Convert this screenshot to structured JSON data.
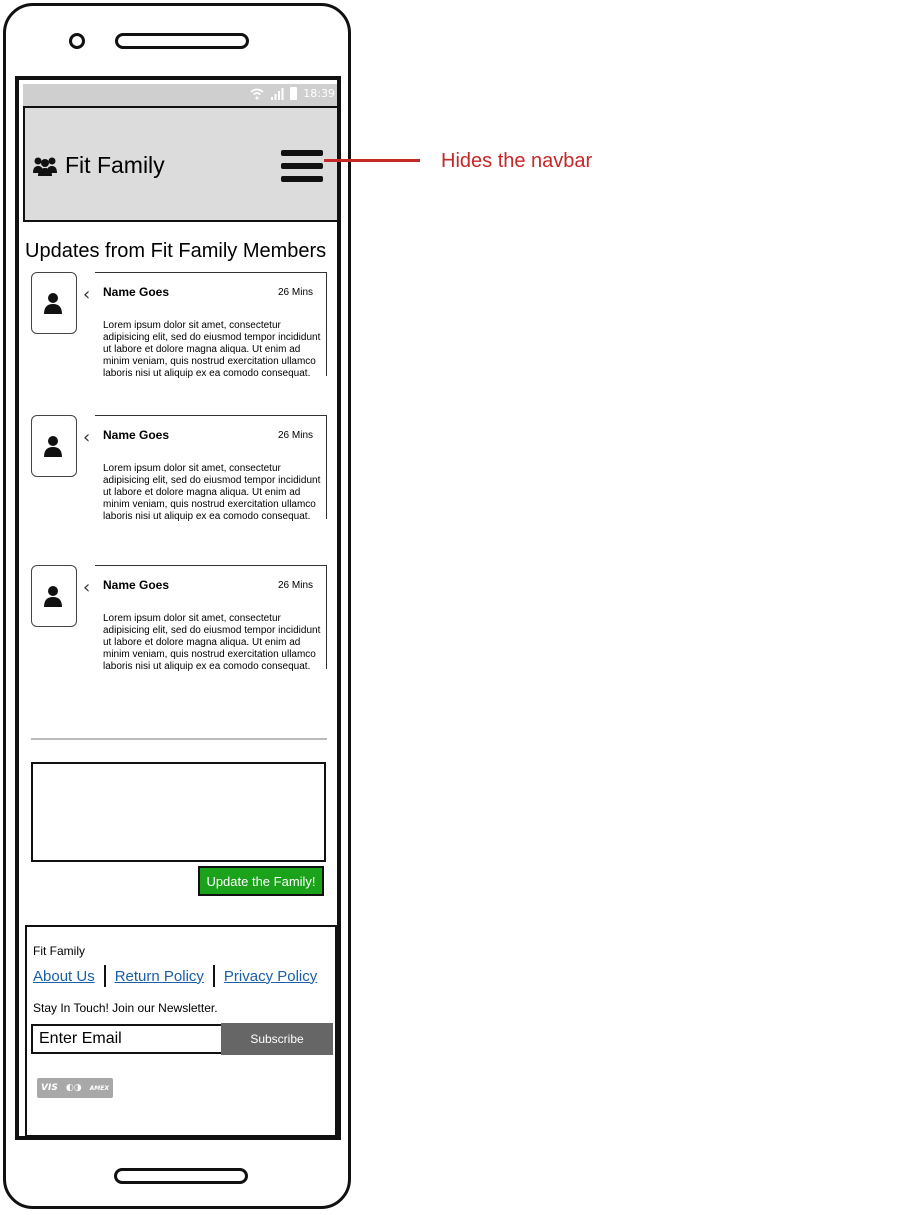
{
  "status_bar": {
    "time": "18:39"
  },
  "header": {
    "brand": "Fit Family",
    "brand_icon": "users-icon",
    "menu_icon": "hamburger-menu-icon"
  },
  "updates": {
    "title": "Updates from Fit Family Members",
    "posts": [
      {
        "name": "Name Goes",
        "time": "26 Mins",
        "text": "Lorem ipsum dolor sit amet, consectetur adipisicing elit, sed do eiusmod tempor incididunt ut labore et dolore magna aliqua. Ut enim ad minim veniam, quis nostrud exercitation ullamco laboris nisi ut aliquip ex ea comodo consequat."
      },
      {
        "name": "Name Goes",
        "time": "26 Mins",
        "text": "Lorem ipsum dolor sit amet, consectetur adipisicing elit, sed do eiusmod tempor incididunt ut labore et dolore magna aliqua. Ut enim ad minim veniam, quis nostrud exercitation ullamco laboris nisi ut aliquip ex ea comodo consequat."
      },
      {
        "name": "Name Goes",
        "time": "26 Mins",
        "text": "Lorem ipsum dolor sit amet, consectetur adipisicing elit, sed do eiusmod tempor incididunt ut labore et dolore magna aliqua. Ut enim ad minim veniam, quis nostrud exercitation ullamco laboris nisi ut aliquip ex ea comodo consequat."
      }
    ]
  },
  "composer": {
    "button_label": "Update the Family!",
    "button_color": "#1aa31a"
  },
  "footer": {
    "brand": "Fit Family",
    "links": [
      "About Us",
      "Return Policy",
      "Privacy Policy"
    ],
    "newsletter_text": "Stay In Touch! Join our Newsletter.",
    "email_placeholder": "Enter Email",
    "subscribe_label": "Subscribe",
    "payment_logos": [
      "VISA",
      "Mastercard",
      "American Express"
    ]
  },
  "annotation": {
    "text": "Hides the navbar",
    "color": "#c62828"
  }
}
